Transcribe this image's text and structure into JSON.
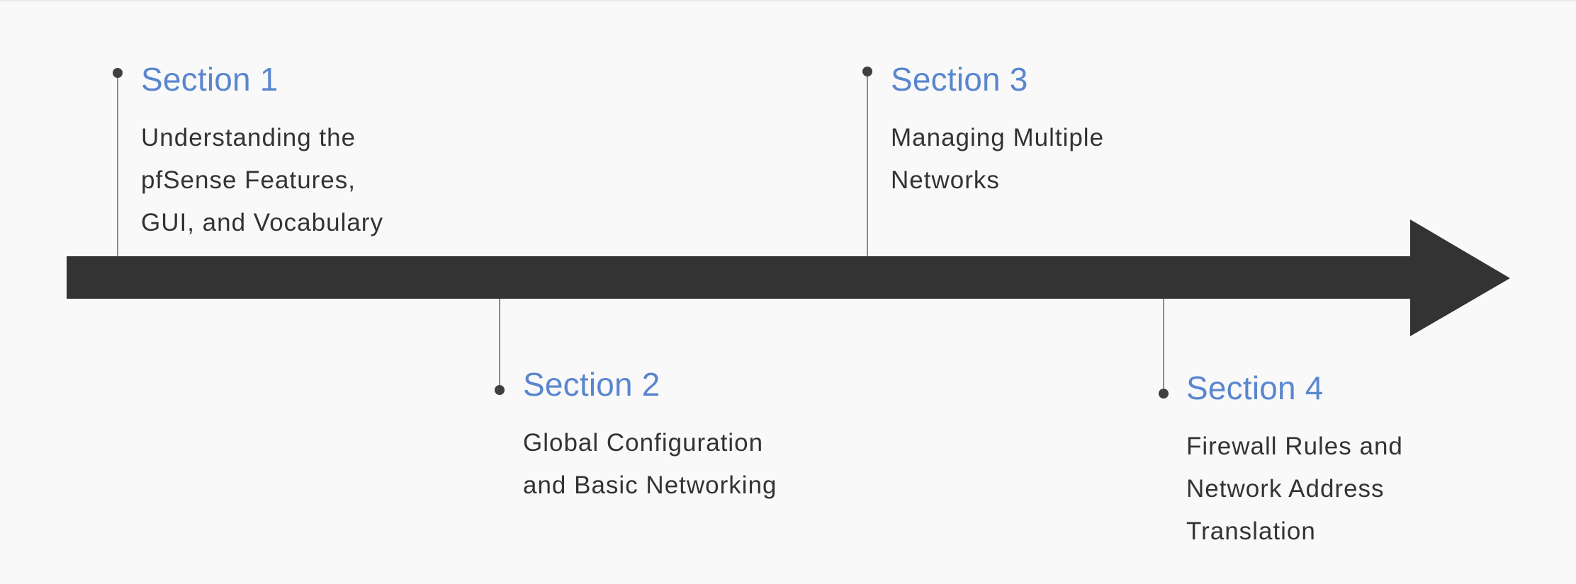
{
  "colors": {
    "background": "#f9f9f9",
    "arrow": "#333333",
    "title": "#5a86cf",
    "text": "#333333",
    "connector": "#8c8c8c",
    "marker": "#3f3f3f"
  },
  "timeline": {
    "sections": [
      {
        "title": "Section 1",
        "description_lines": [
          "Understanding the",
          "pfSense Features,",
          "GUI, and Vocabulary"
        ]
      },
      {
        "title": "Section 2",
        "description_lines": [
          "Global Configuration",
          "and Basic Networking"
        ]
      },
      {
        "title": "Section 3",
        "description_lines": [
          "Managing Multiple",
          "Networks"
        ]
      },
      {
        "title": "Section 4",
        "description_lines": [
          "Firewall Rules and",
          "Network Address",
          "Translation"
        ]
      }
    ]
  }
}
